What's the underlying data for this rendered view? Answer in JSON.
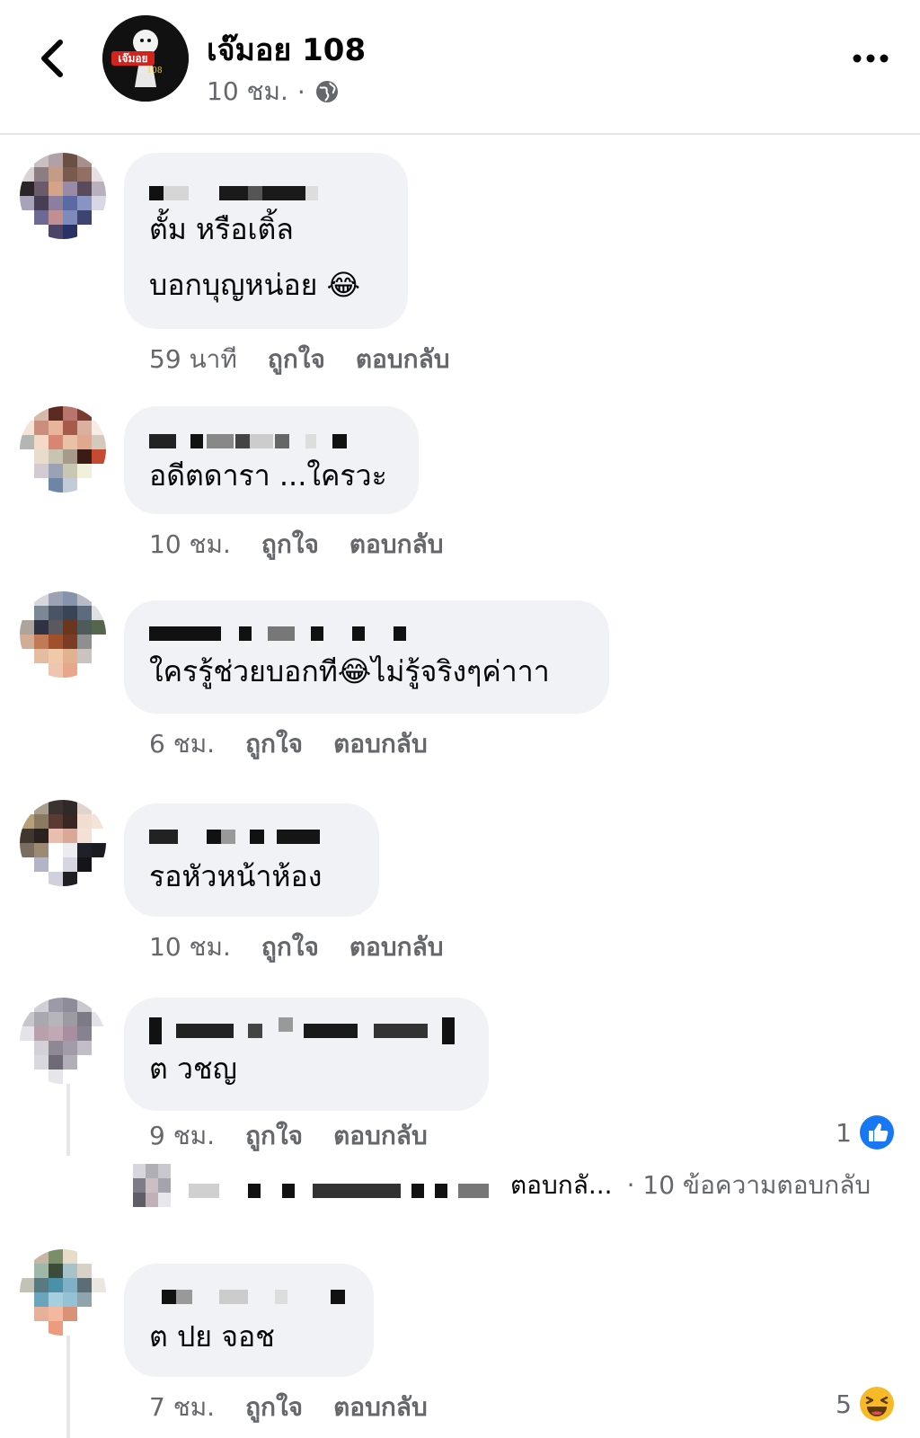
{
  "header": {
    "page_name": "เจ๊มอย 108",
    "time": "10 ชม.",
    "separator": "·",
    "avatar_text": "เจ๊มอย",
    "avatar_number": "108"
  },
  "comments": [
    {
      "text": "ตั้ม หรือเติ้ล\nบอกบุญหน่อย 😂",
      "time": "59 นาที",
      "like": "ถูกใจ",
      "reply": "ตอบกลับ"
    },
    {
      "text": "อดีตดารา ...ใครวะ",
      "time": "10 ชม.",
      "like": "ถูกใจ",
      "reply": "ตอบกลับ"
    },
    {
      "text": "ใครรู้ช่วยบอกที😂ไม่รู้จริงๆค่าาา",
      "time": "6 ชม.",
      "like": "ถูกใจ",
      "reply": "ตอบกลับ"
    },
    {
      "text": "รอหัวหน้าห้อง",
      "time": "10 ชม.",
      "like": "ถูกใจ",
      "reply": "ตอบกลับ"
    },
    {
      "text": "ต วชญ",
      "time": "9 ชม.",
      "like": "ถูกใจ",
      "reply": "ตอบกลับ",
      "reaction_count": "1"
    },
    {
      "text": "ต ปย จอช",
      "time": "7 ชม.",
      "like": "ถูกใจ",
      "reply": "ตอบกลับ",
      "reaction_count": "5"
    }
  ],
  "reply_preview": {
    "text": "ตอบกลั...",
    "count": "· 10 ข้อความตอบกลับ"
  },
  "icons": {
    "back": "chevron-left-icon",
    "more": "more-horizontal-icon",
    "audience": "globe-icon",
    "like_reaction": "like-reaction-icon",
    "haha_reaction": "haha-reaction-icon"
  },
  "colors": {
    "bubble": "#f0f2f5",
    "muted_text": "#65676b",
    "like_blue": "#1877f2",
    "haha_yellow": "#f7b928"
  }
}
